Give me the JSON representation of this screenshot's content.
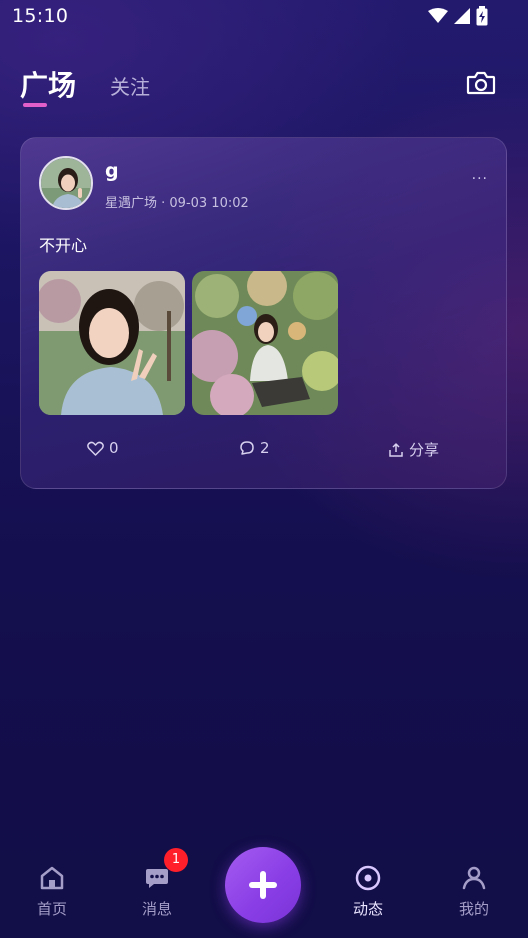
{
  "status_bar": {
    "time": "15:10"
  },
  "header": {
    "tabs": [
      {
        "label": "广场",
        "active": true
      },
      {
        "label": "关注",
        "active": false
      }
    ],
    "camera_icon": "camera-icon"
  },
  "post": {
    "username": "g",
    "meta": "星遇广场 · 09-03 10:02",
    "more": "···",
    "text": "不开心",
    "likes": "0",
    "comments": "2",
    "share_label": "分享"
  },
  "bottom_nav": {
    "items": [
      {
        "label": "首页",
        "icon": "home-icon",
        "active": false
      },
      {
        "label": "消息",
        "icon": "chat-bubble-icon",
        "active": false,
        "badge": "1"
      },
      {
        "label": "动态",
        "icon": "circle-dot-icon",
        "active": true
      },
      {
        "label": "我的",
        "icon": "person-icon",
        "active": false
      }
    ],
    "add_button_icon": "plus-icon"
  },
  "colors": {
    "accent_indicator": "#e05fc8",
    "add_button": "#9a4ee9",
    "badge": "#ff1f2a",
    "background": "#140f4e"
  }
}
